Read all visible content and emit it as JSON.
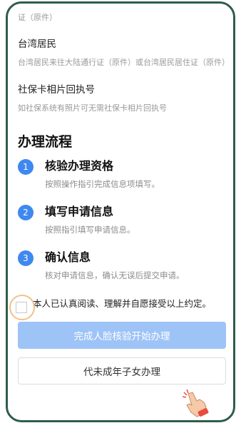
{
  "documents": [
    {
      "tail": "证（原件）"
    },
    {
      "title": "台湾居民",
      "desc": "台湾居民来往大陆通行证（原件）或台湾居民居住证（原件）"
    },
    {
      "title": "社保卡相片回执号",
      "desc": "如社保系统有照片可无需社保卡相片回执号"
    }
  ],
  "process": {
    "title": "办理流程",
    "steps": [
      {
        "num": "1",
        "title": "核验办理资格",
        "desc": "按照操作指引完成信息项填写。"
      },
      {
        "num": "2",
        "title": "填写申请信息",
        "desc": "按照指引填写申请信息。"
      },
      {
        "num": "3",
        "title": "确认信息",
        "desc": "核对申请信息，确认无误后提交申请。"
      }
    ]
  },
  "agreement": {
    "text": "本人已认真阅读、理解并自愿接受以上约定。",
    "checked": false
  },
  "buttons": {
    "primary": "完成人脸核验开始办理",
    "secondary": "代未成年子女办理"
  },
  "colors": {
    "accent": "#3f88ef",
    "primary_disabled": "#9ec3f7",
    "frame": "#2f5d4a",
    "highlight_ring": "#f2c08a"
  }
}
